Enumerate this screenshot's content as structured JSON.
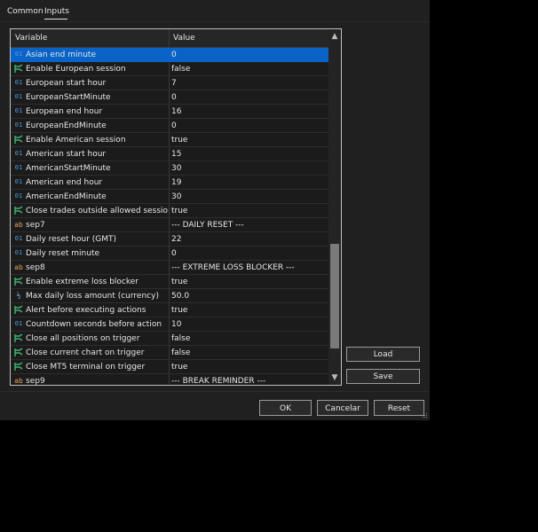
{
  "tabs": [
    {
      "label": "Common",
      "active": false
    },
    {
      "label": "Inputs",
      "active": true
    }
  ],
  "grid": {
    "columns": {
      "variable": "Variable",
      "value": "Value"
    },
    "rows": [
      {
        "type": "int",
        "icon": "01",
        "variable": "Asian end minute",
        "value": "0",
        "selected": true
      },
      {
        "type": "bool",
        "icon": "",
        "variable": "Enable European session",
        "value": "false"
      },
      {
        "type": "int",
        "icon": "01",
        "variable": "European start hour",
        "value": "7"
      },
      {
        "type": "int",
        "icon": "01",
        "variable": "EuropeanStartMinute",
        "value": "0"
      },
      {
        "type": "int",
        "icon": "01",
        "variable": "European end hour",
        "value": "16"
      },
      {
        "type": "int",
        "icon": "01",
        "variable": "EuropeanEndMinute",
        "value": "0"
      },
      {
        "type": "bool",
        "icon": "",
        "variable": "Enable American session",
        "value": "true"
      },
      {
        "type": "int",
        "icon": "01",
        "variable": "American start hour",
        "value": "15"
      },
      {
        "type": "int",
        "icon": "01",
        "variable": "AmericanStartMinute",
        "value": "30"
      },
      {
        "type": "int",
        "icon": "01",
        "variable": "American end hour",
        "value": "19"
      },
      {
        "type": "int",
        "icon": "01",
        "variable": "AmericanEndMinute",
        "value": "30"
      },
      {
        "type": "bool",
        "icon": "",
        "variable": "Close trades outside allowed sessions",
        "value": "true"
      },
      {
        "type": "str",
        "icon": "ab",
        "variable": "sep7",
        "value": "--- DAILY RESET ---"
      },
      {
        "type": "int",
        "icon": "01",
        "variable": "Daily reset hour (GMT)",
        "value": "22"
      },
      {
        "type": "int",
        "icon": "01",
        "variable": "Daily reset minute",
        "value": "0"
      },
      {
        "type": "str",
        "icon": "ab",
        "variable": "sep8",
        "value": "--- EXTREME LOSS BLOCKER ---"
      },
      {
        "type": "bool",
        "icon": "",
        "variable": "Enable extreme loss blocker",
        "value": "true"
      },
      {
        "type": "frac",
        "icon": "½",
        "variable": "Max daily loss amount (currency)",
        "value": "50.0"
      },
      {
        "type": "bool",
        "icon": "",
        "variable": "Alert before executing actions",
        "value": "true"
      },
      {
        "type": "int",
        "icon": "01",
        "variable": "Countdown seconds before action",
        "value": "10"
      },
      {
        "type": "bool",
        "icon": "",
        "variable": "Close all positions on trigger",
        "value": "false"
      },
      {
        "type": "bool",
        "icon": "",
        "variable": "Close current chart on trigger",
        "value": "false"
      },
      {
        "type": "bool",
        "icon": "",
        "variable": "Close MT5 terminal on trigger",
        "value": "true"
      },
      {
        "type": "str",
        "icon": "ab",
        "variable": "sep9",
        "value": "--- BREAK REMINDER ---"
      }
    ]
  },
  "scrollbar": {
    "up_glyph": "▲",
    "down_glyph": "▼",
    "position_fraction": 0.62
  },
  "buttons": {
    "load": "Load",
    "save": "Save",
    "ok": "OK",
    "cancel": "Cancelar",
    "reset": "Reset"
  },
  "colors": {
    "selection": "#0a64c8",
    "bool_icon": "#3cb371",
    "int_icon": "#4d9de0",
    "str_icon": "#e3a15c"
  }
}
